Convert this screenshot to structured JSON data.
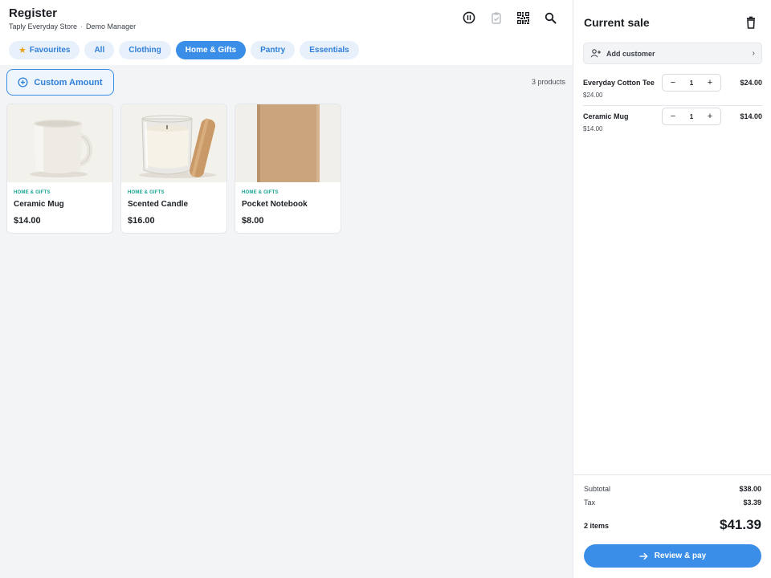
{
  "header": {
    "title": "Register",
    "store": "Taply Everyday Store",
    "separator": "·",
    "user": "Demo Manager"
  },
  "toolbar_icons": [
    "pause-icon",
    "clipboard-check-icon",
    "qr-code-icon",
    "search-icon"
  ],
  "categories": [
    {
      "label": "Favourites",
      "icon": "star-icon",
      "active": false
    },
    {
      "label": "All",
      "active": false
    },
    {
      "label": "Clothing",
      "active": false
    },
    {
      "label": "Home & Gifts",
      "active": true
    },
    {
      "label": "Pantry",
      "active": false
    },
    {
      "label": "Essentials",
      "active": false
    }
  ],
  "custom_amount": {
    "label": "Custom Amount",
    "icon": "plus-circle-icon"
  },
  "product_count": "3 products",
  "products": [
    {
      "category": "HOME & GIFTS",
      "name": "Ceramic Mug",
      "price": "$14.00"
    },
    {
      "category": "HOME & GIFTS",
      "name": "Scented Candle",
      "price": "$16.00"
    },
    {
      "category": "HOME & GIFTS",
      "name": "Pocket Notebook",
      "price": "$8.00"
    }
  ],
  "sale": {
    "title": "Current sale",
    "add_customer": "Add customer",
    "items": [
      {
        "name": "Everyday Cotton Tee",
        "unit_price": "$24.00",
        "qty": "1",
        "total": "$24.00"
      },
      {
        "name": "Ceramic Mug",
        "unit_price": "$14.00",
        "qty": "1",
        "total": "$14.00"
      }
    ],
    "subtotal_label": "Subtotal",
    "subtotal": "$38.00",
    "tax_label": "Tax",
    "tax": "$3.39",
    "items_count": "2 items",
    "total": "$41.39",
    "pay_label": "Review & pay"
  },
  "colors": {
    "accent": "#3a8ee8",
    "teal": "#13a392",
    "chip_bg": "#e8f1fb",
    "star": "#e6a21a"
  }
}
